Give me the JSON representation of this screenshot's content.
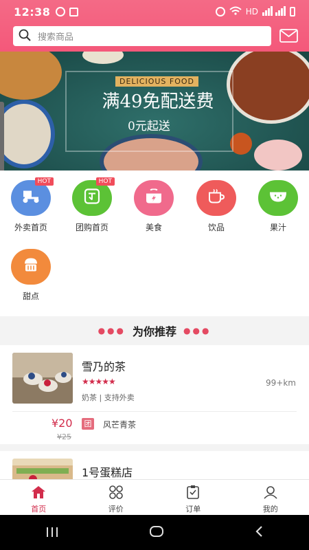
{
  "status_bar": {
    "time": "12:38",
    "network": "HD"
  },
  "search": {
    "placeholder": "搜索商品",
    "icon": "search-icon"
  },
  "header": {
    "mail_icon": "mail-icon",
    "accent": "#f4587a"
  },
  "banner": {
    "tag": "DELICIOUS FOOD",
    "title": "满49免配送费",
    "subtitle": "0元起送"
  },
  "categories": [
    {
      "label": "外卖首页",
      "hot": "HOT",
      "color": "#5b8fe0",
      "icon": "scooter-icon"
    },
    {
      "label": "团购首页",
      "hot": "HOT",
      "color": "#5cc236",
      "icon": "group-buy-icon"
    },
    {
      "label": "美食",
      "hot": "",
      "color": "#f06a8c",
      "icon": "pot-icon"
    },
    {
      "label": "饮品",
      "hot": "",
      "color": "#ef5b5b",
      "icon": "cup-icon"
    },
    {
      "label": "果汁",
      "hot": "",
      "color": "#5cc236",
      "icon": "watermelon-icon"
    },
    {
      "label": "甜点",
      "hot": "",
      "color": "#f28a3c",
      "icon": "cake-icon"
    }
  ],
  "recommend": {
    "title": "为你推荐",
    "shops": [
      {
        "name": "雪乃的茶",
        "rating": 5,
        "stars": "★★★★★",
        "distance": "99+km",
        "meta": "奶茶 | 支持外卖",
        "price": "¥20",
        "original_price": "¥25",
        "deal_badge": "团",
        "deal": "风芒青茶"
      },
      {
        "name": "1号蛋糕店"
      }
    ]
  },
  "tabs": [
    {
      "label": "首页",
      "icon": "home-icon",
      "active": true
    },
    {
      "label": "评价",
      "icon": "grid-icon",
      "active": false
    },
    {
      "label": "订单",
      "icon": "order-icon",
      "active": false
    },
    {
      "label": "我的",
      "icon": "user-icon",
      "active": false
    }
  ]
}
